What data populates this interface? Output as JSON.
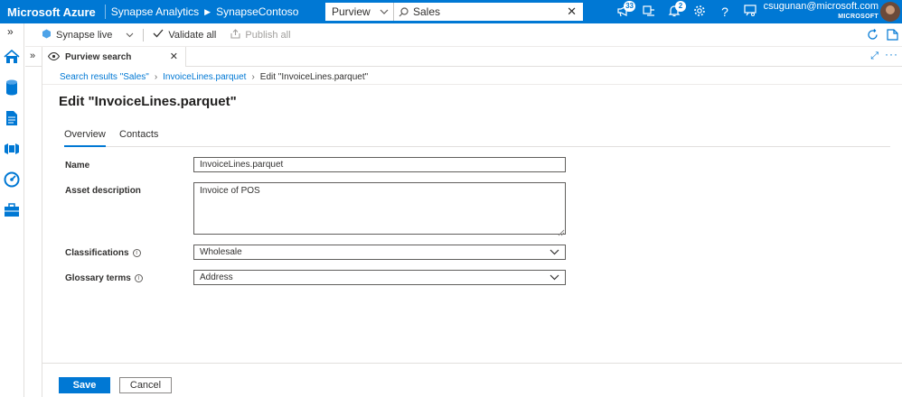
{
  "topbar": {
    "brand": "Microsoft Azure",
    "breadcrumb": [
      "Synapse Analytics",
      "SynapseContoso"
    ],
    "search": {
      "scope": "Purview",
      "value": "Sales"
    },
    "badges": {
      "feedback": "33",
      "notifications": "2"
    },
    "user": {
      "email": "csugunan@microsoft.com",
      "org": "MICROSOFT"
    }
  },
  "toolbar": {
    "mode": "Synapse live",
    "validate_all": "Validate all",
    "publish_all": "Publish all"
  },
  "tab": {
    "label": "Purview search"
  },
  "breadcrumb": {
    "search_results": "Search results \"Sales\"",
    "asset": "InvoiceLines.parquet",
    "current": "Edit \"InvoiceLines.parquet\""
  },
  "page": {
    "title": "Edit \"InvoiceLines.parquet\"",
    "tabs": [
      "Overview",
      "Contacts"
    ]
  },
  "form": {
    "name": {
      "label": "Name",
      "value": "InvoiceLines.parquet"
    },
    "description": {
      "label": "Asset description",
      "value": "Invoice of POS"
    },
    "classifications": {
      "label": "Classifications",
      "value": "Wholesale"
    },
    "glossary": {
      "label": "Glossary terms",
      "value": "Address"
    }
  },
  "buttons": {
    "save": "Save",
    "cancel": "Cancel"
  },
  "colors": {
    "accent": "#0078d4",
    "header": "#0078d4"
  }
}
